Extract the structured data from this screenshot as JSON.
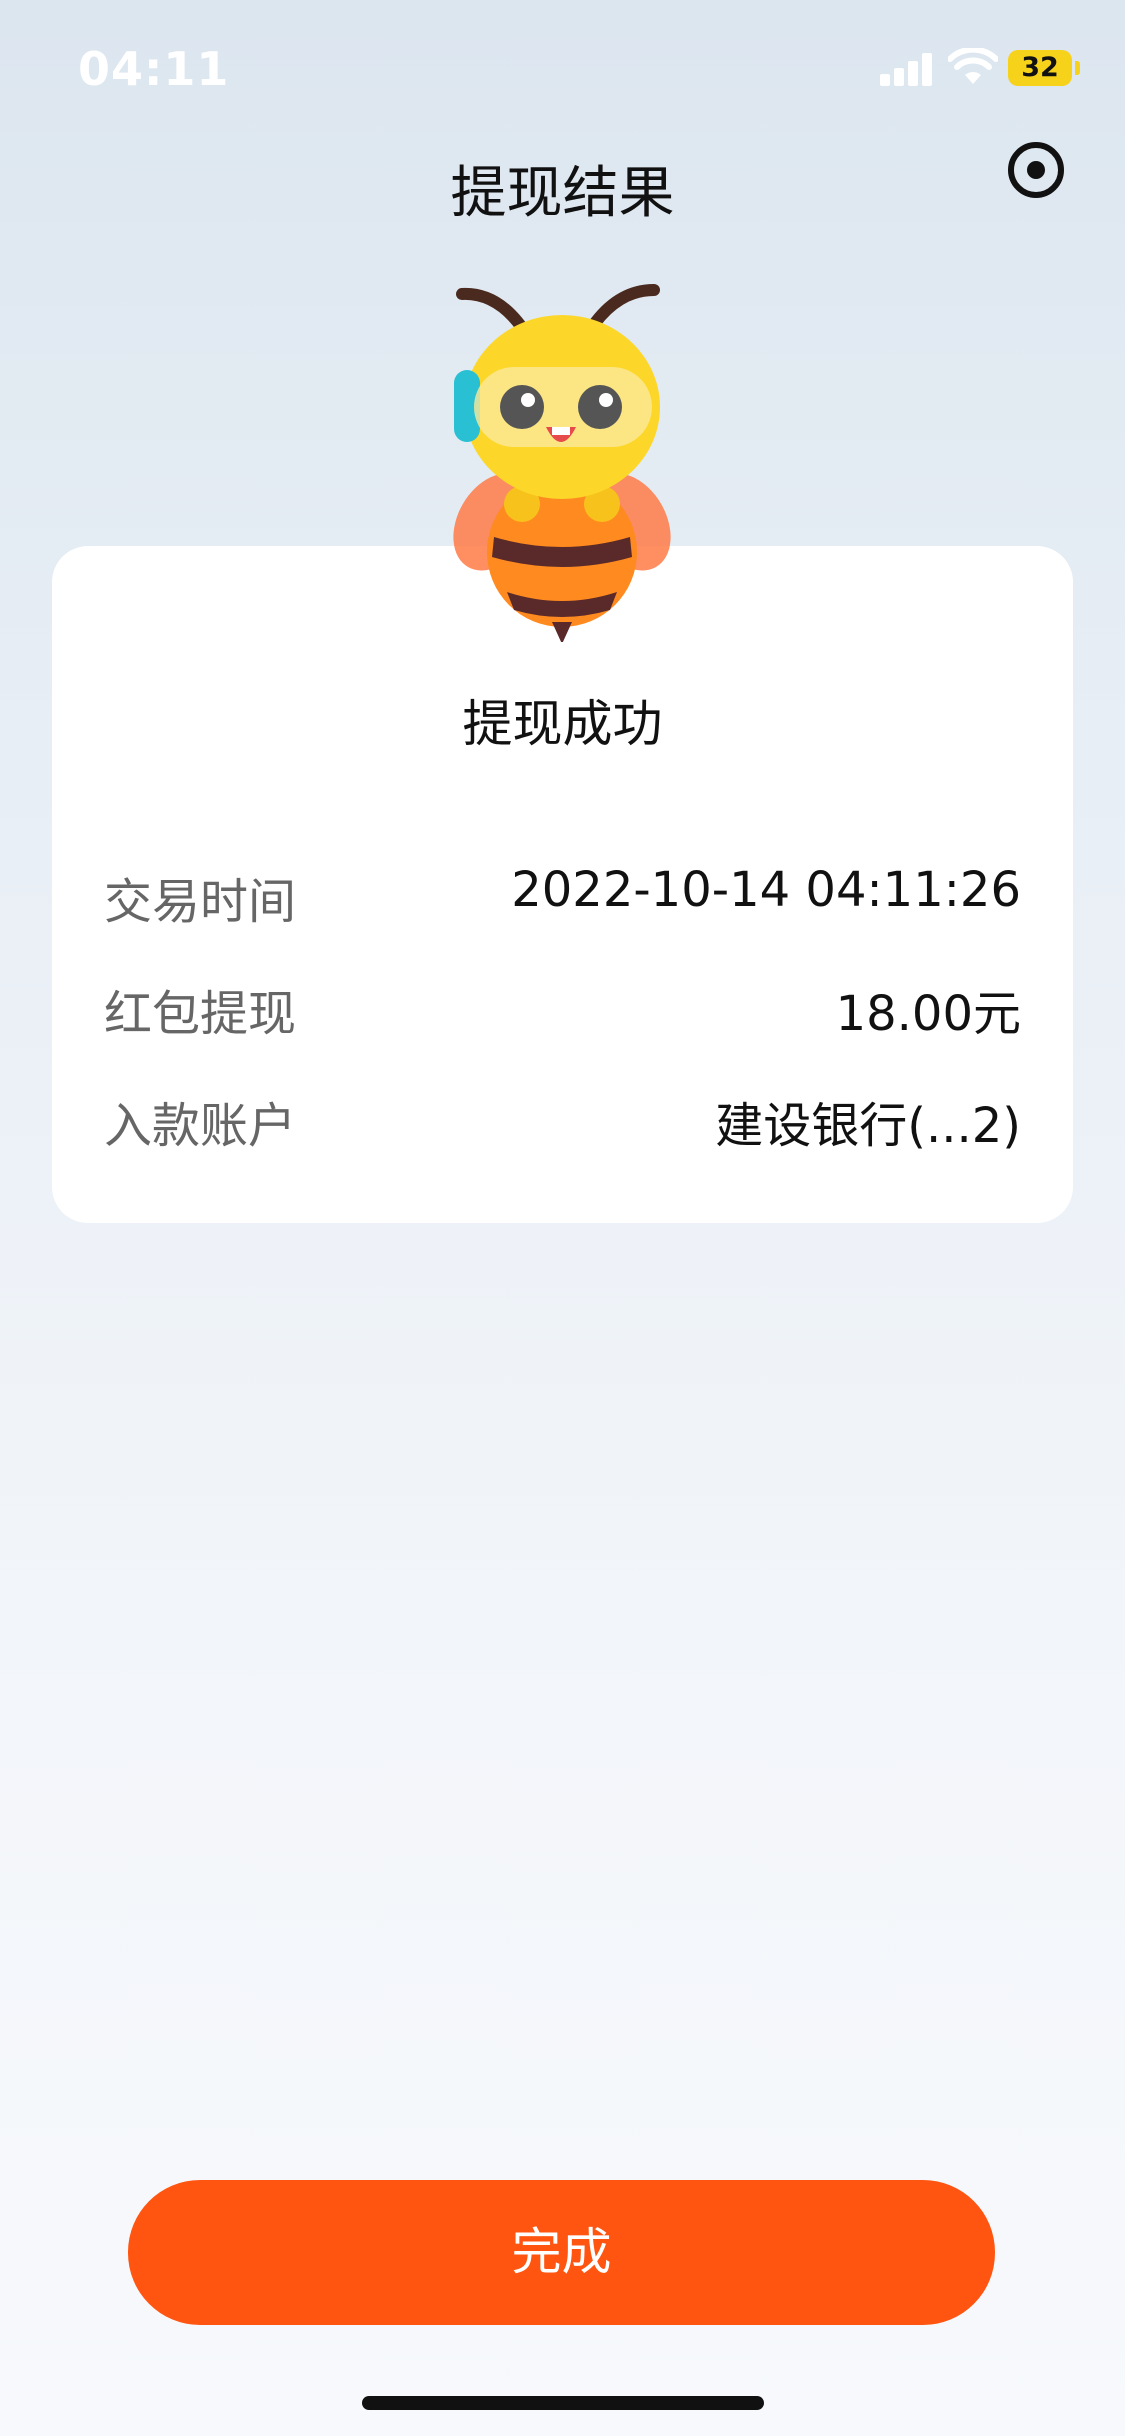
{
  "status_bar": {
    "time": "04:11",
    "battery_level": "32",
    "battery_color": "#f6d21b"
  },
  "header": {
    "title": "提现结果",
    "action_icon": "record-icon"
  },
  "mascot": {
    "icon": "bee-mascot-icon"
  },
  "result": {
    "status": "提现成功",
    "rows": [
      {
        "label": "交易时间",
        "value": "2022-10-14 04:11:26"
      },
      {
        "label": "红包提现",
        "value": "18.00元"
      },
      {
        "label": "入款账户",
        "value": "建设银行(...2)"
      }
    ]
  },
  "footer": {
    "done_label": "完成",
    "accent_color": "#ff5510"
  }
}
